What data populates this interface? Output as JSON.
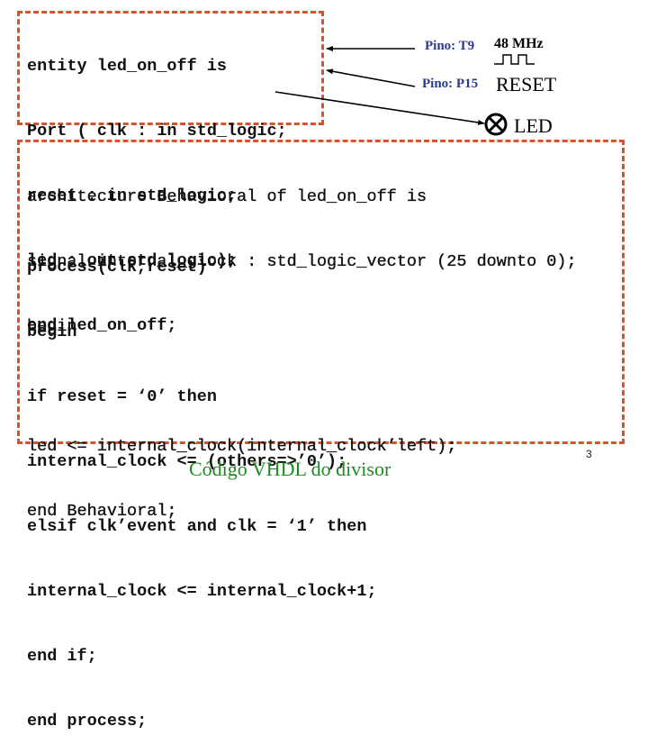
{
  "entity_block": {
    "lines": [
      "entity led_on_off is",
      "Port ( clk : in std_logic;",
      "reset : in std_logic;",
      "led : out std_logic);",
      "end led_on_off;"
    ]
  },
  "architecture_block": {
    "header_lines": [
      "architecture Behavioral of led_on_off is",
      "signal internal_clock : std_logic_vector (25 downto 0);",
      "begin"
    ],
    "process_lines": [
      "process(clk,reset)",
      "begin",
      "if reset = ‘0’ then",
      "internal_clock <= (others=>’0’);",
      "elsif clk’event and clk = ‘1’ then",
      "internal_clock <= internal_clock+1;",
      "end if;",
      "end process;"
    ],
    "tail_lines": [
      "led <= internal_clock(internal_clock’left);",
      "end Behavioral;"
    ]
  },
  "pins": {
    "clk": {
      "pin_label": "Pino: T9",
      "signal_label": "48 MHz",
      "icon": "clock-waveform-icon"
    },
    "reset": {
      "pin_label": "Pino: P15",
      "signal_label": "RESET"
    },
    "led": {
      "signal_label": "LED",
      "icon": "lamp-icon"
    }
  },
  "caption": "Código VHDL do divisor",
  "page_number": "3",
  "colors": {
    "box_border": "#d9532a",
    "pin_label": "#2b3a8c",
    "caption": "#1f8a24"
  }
}
